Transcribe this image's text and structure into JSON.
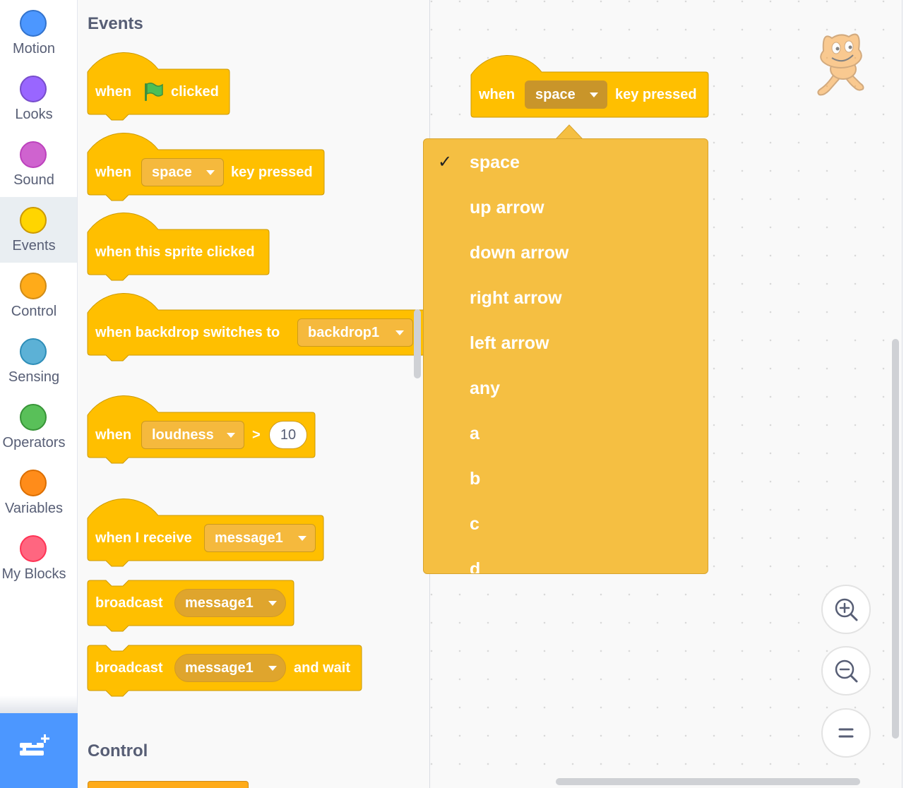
{
  "categories": [
    {
      "label": "Motion",
      "color": "#4c97ff",
      "border": "#3373cc"
    },
    {
      "label": "Looks",
      "color": "#9966ff",
      "border": "#774dcb"
    },
    {
      "label": "Sound",
      "color": "#cf63cf",
      "border": "#bd42bd"
    },
    {
      "label": "Events",
      "color": "#ffd500",
      "border": "#cc9900",
      "selected": true
    },
    {
      "label": "Control",
      "color": "#ffab19",
      "border": "#cf8b17"
    },
    {
      "label": "Sensing",
      "color": "#5cb1d6",
      "border": "#2e8eb8"
    },
    {
      "label": "Operators",
      "color": "#59c059",
      "border": "#389438"
    },
    {
      "label": "Variables",
      "color": "#ff8c1a",
      "border": "#db6e00"
    },
    {
      "label": "My Blocks",
      "color": "#ff6680",
      "border": "#ff3355"
    }
  ],
  "palette": {
    "events_heading": "Events",
    "control_heading": "Control",
    "blocks": {
      "flag": {
        "when": "when",
        "clicked": "clicked"
      },
      "key": {
        "when": "when",
        "key": "space",
        "pressed": "key pressed"
      },
      "sprite": {
        "text": "when this sprite clicked"
      },
      "backdrop": {
        "text": "when backdrop switches to",
        "value": "backdrop1"
      },
      "loudness": {
        "when": "when",
        "sensor": "loudness",
        "op": ">",
        "value": "10"
      },
      "receive": {
        "text": "when I receive",
        "value": "message1"
      },
      "broadcast": {
        "text": "broadcast",
        "value": "message1"
      },
      "broadcast_wait": {
        "text": "broadcast",
        "value": "message1",
        "suffix": "and wait"
      }
    }
  },
  "workspace": {
    "block": {
      "when": "when",
      "key": "space",
      "pressed": "key pressed"
    },
    "dropdown": {
      "selected_mark": "✓",
      "options": [
        "space",
        "up arrow",
        "down arrow",
        "right arrow",
        "left arrow",
        "any",
        "a",
        "b",
        "c",
        "d"
      ]
    }
  },
  "colors": {
    "event_block": "#ffbf00",
    "event_border": "#cc9900",
    "menu_bg": "#f5bf42",
    "accent": "#4c97ff"
  }
}
